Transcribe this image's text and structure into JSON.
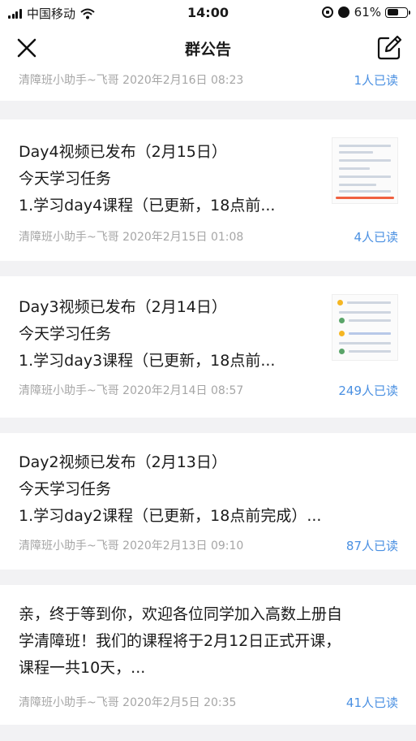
{
  "status_bar": {
    "carrier": "中国移动",
    "time": "14:00",
    "battery": "61%"
  },
  "navbar": {
    "title": "群公告",
    "close_icon": "close-icon",
    "edit_icon": "compose-icon"
  },
  "announcements": [
    {
      "meta": "清障班小助手~飞哥 2020年2月16日 08:23",
      "read": "1人已读"
    },
    {
      "title": "Day4视频已发布（2月15日）",
      "line2": "今天学习任务",
      "line3": "1.学习day4课程（已更新，18点前...",
      "meta": "清障班小助手~飞哥 2020年2月15日 01:08",
      "read": "4人已读"
    },
    {
      "title": "Day3视频已发布（2月14日）",
      "line2": "今天学习任务",
      "line3": "1.学习day3课程（已更新，18点前...",
      "meta": "清障班小助手~飞哥 2020年2月14日 08:57",
      "read": "249人已读"
    },
    {
      "title": "Day2视频已发布（2月13日）",
      "line2": "今天学习任务",
      "line3": "1.学习day2课程（已更新，18点前完成）...",
      "meta": "清障班小助手~飞哥 2020年2月13日 09:10",
      "read": "87人已读"
    },
    {
      "title": "亲，终于等到你，欢迎各位同学加入高数上册自",
      "line2": "学清障班！我们的课程将于2月12日正式开课，",
      "line3": "课程一共10天，...",
      "meta": "清障班小助手~飞哥 2020年2月5日 20:35",
      "read": "41人已读"
    }
  ],
  "colors": {
    "accent": "#4a90e2",
    "meta_gray": "#a6a6a6",
    "separator": "#f2f2f4"
  }
}
